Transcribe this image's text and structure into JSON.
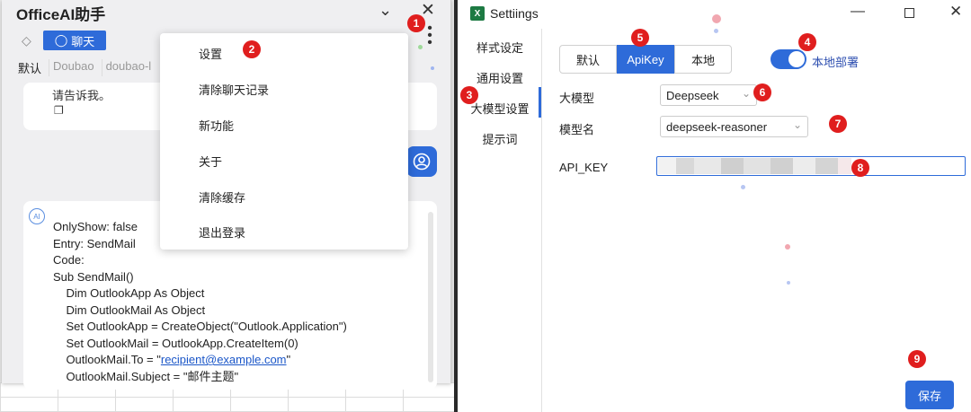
{
  "assistant": {
    "title": "OfficeAI助手",
    "chat_tab": "聊天",
    "models": [
      "默认",
      "Doubao",
      "doubao-l"
    ],
    "card1_text": "请告诉我。",
    "code_lines": [
      "OnlyShow: false",
      "Entry: SendMail",
      "Code:",
      "Sub SendMail()",
      "    Dim OutlookApp As Object",
      "    Dim OutlookMail As Object",
      "    Set OutlookApp = CreateObject(\"Outlook.Application\")",
      "    Set OutlookMail = OutlookApp.CreateItem(0)",
      "",
      "    OutlookMail.To = \"recipient@example.com\"",
      "    OutlookMail.Subject = \"邮件主题\""
    ],
    "menu_items": [
      "设置",
      "清除聊天记录",
      "新功能",
      "关于",
      "清除缓存",
      "退出登录"
    ]
  },
  "settings": {
    "title": "Settiings",
    "nav": [
      "样式设定",
      "通用设置",
      "大模型设置",
      "提示词"
    ],
    "segments": [
      "默认",
      "ApiKey",
      "本地"
    ],
    "toggle_label": "本地部署",
    "llm_label": "大模型",
    "llm_value": "Deepseek",
    "model_label": "模型名",
    "model_value": "deepseek-reasoner",
    "api_key_label": "API_KEY",
    "save_label": "保存"
  },
  "badges": [
    "1",
    "2",
    "3",
    "4",
    "5",
    "6",
    "7",
    "8",
    "9"
  ],
  "colors": {
    "accent": "#2e6bd9",
    "badge": "#e01e1e",
    "excel": "#1d7a43"
  }
}
